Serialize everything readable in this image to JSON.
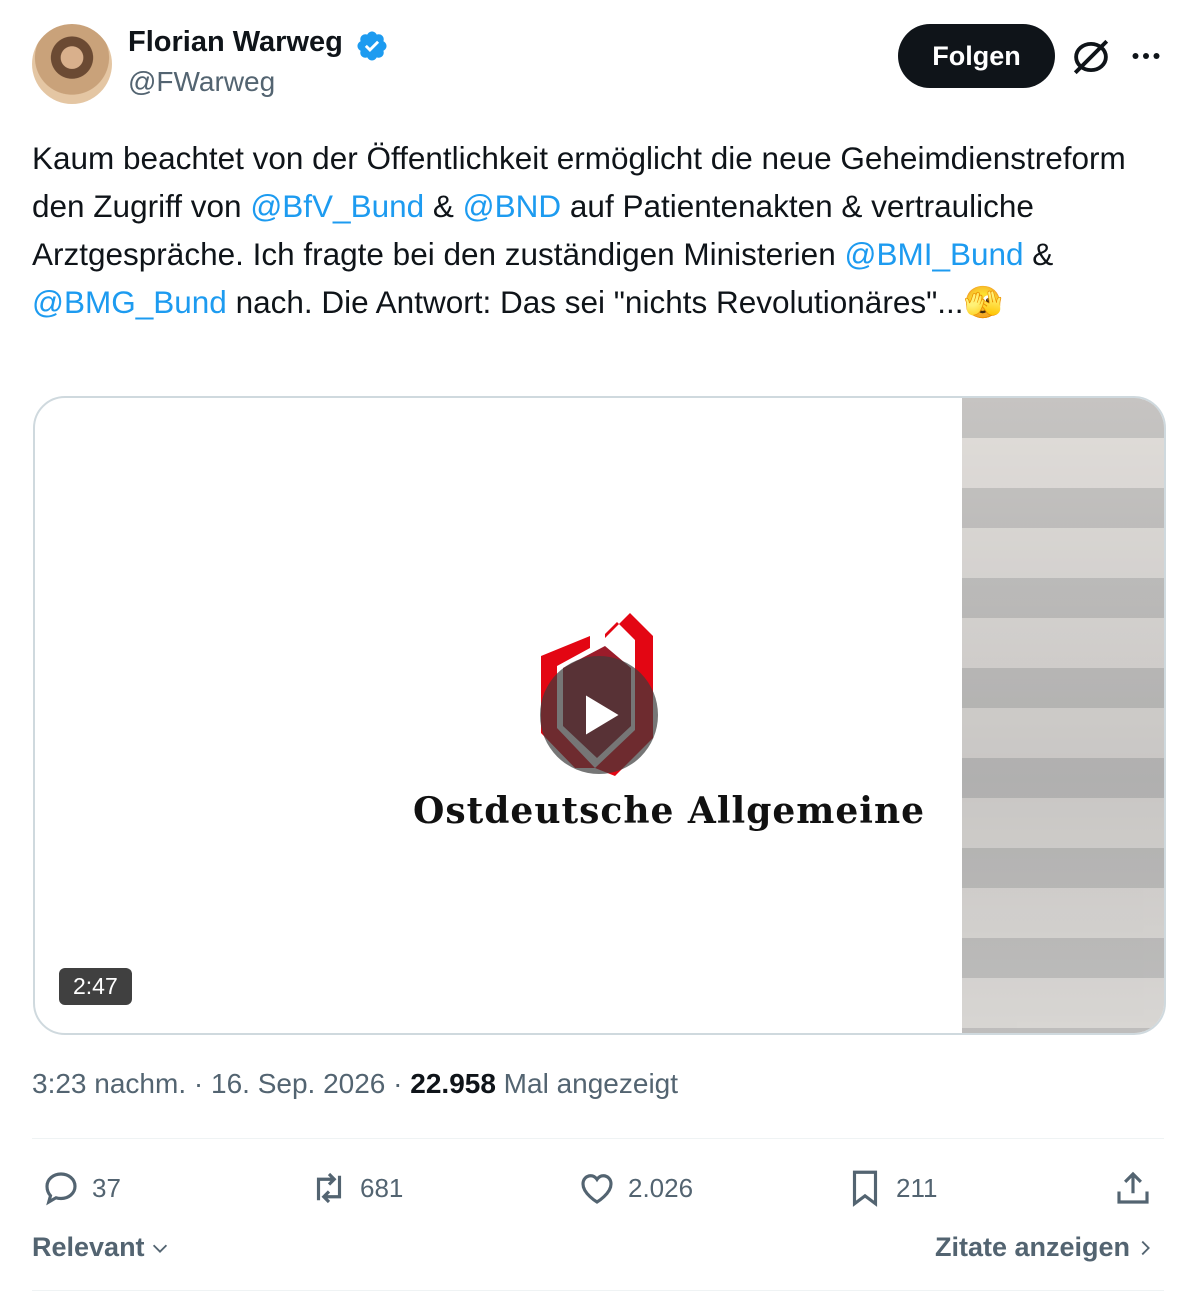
{
  "author": {
    "name": "Florian Warweg",
    "handle": "@FWarweg",
    "verified": true
  },
  "follow_button": "Folgen",
  "icons": {
    "grok": "grok-icon",
    "more": "more-icon",
    "verified": "verified-badge-icon"
  },
  "tweet": {
    "t1": "Kaum beachtet von der Öffentlichkeit ermöglicht die neue Geheimdienstreform den Zugriff von ",
    "m1": "@BfV_Bund",
    "t2": " & ",
    "m2": "@BND",
    "t3": " auf Patientenakten & vertrauliche Arztgespräche. Ich fragte bei den zuständigen Ministerien ",
    "m3": "@BMI_Bund",
    "t4": " &  ",
    "m4": "@BMG_Bund",
    "t5": " nach. Die Antwort: Das sei \"nichts Revolutionäres\"...",
    "emoji": "🫣"
  },
  "video": {
    "brand": "Ostdeutsche Allgemeine",
    "duration": "2:47"
  },
  "meta": {
    "time": "3:23 nachm.",
    "sep1": " · ",
    "date": "16. Sep. 2026",
    "sep2": " · ",
    "views": "22.958",
    "views_label": " Mal angezeigt"
  },
  "stats": {
    "replies": "37",
    "reposts": "681",
    "likes": "2.026",
    "bookmarks": "211"
  },
  "footer": {
    "sort": "Relevant",
    "quotes": "Zitate anzeigen"
  },
  "colors": {
    "accent": "#1d9bf0",
    "brand_red": "#e30613",
    "text": "#0f1419",
    "muted": "#536471"
  }
}
